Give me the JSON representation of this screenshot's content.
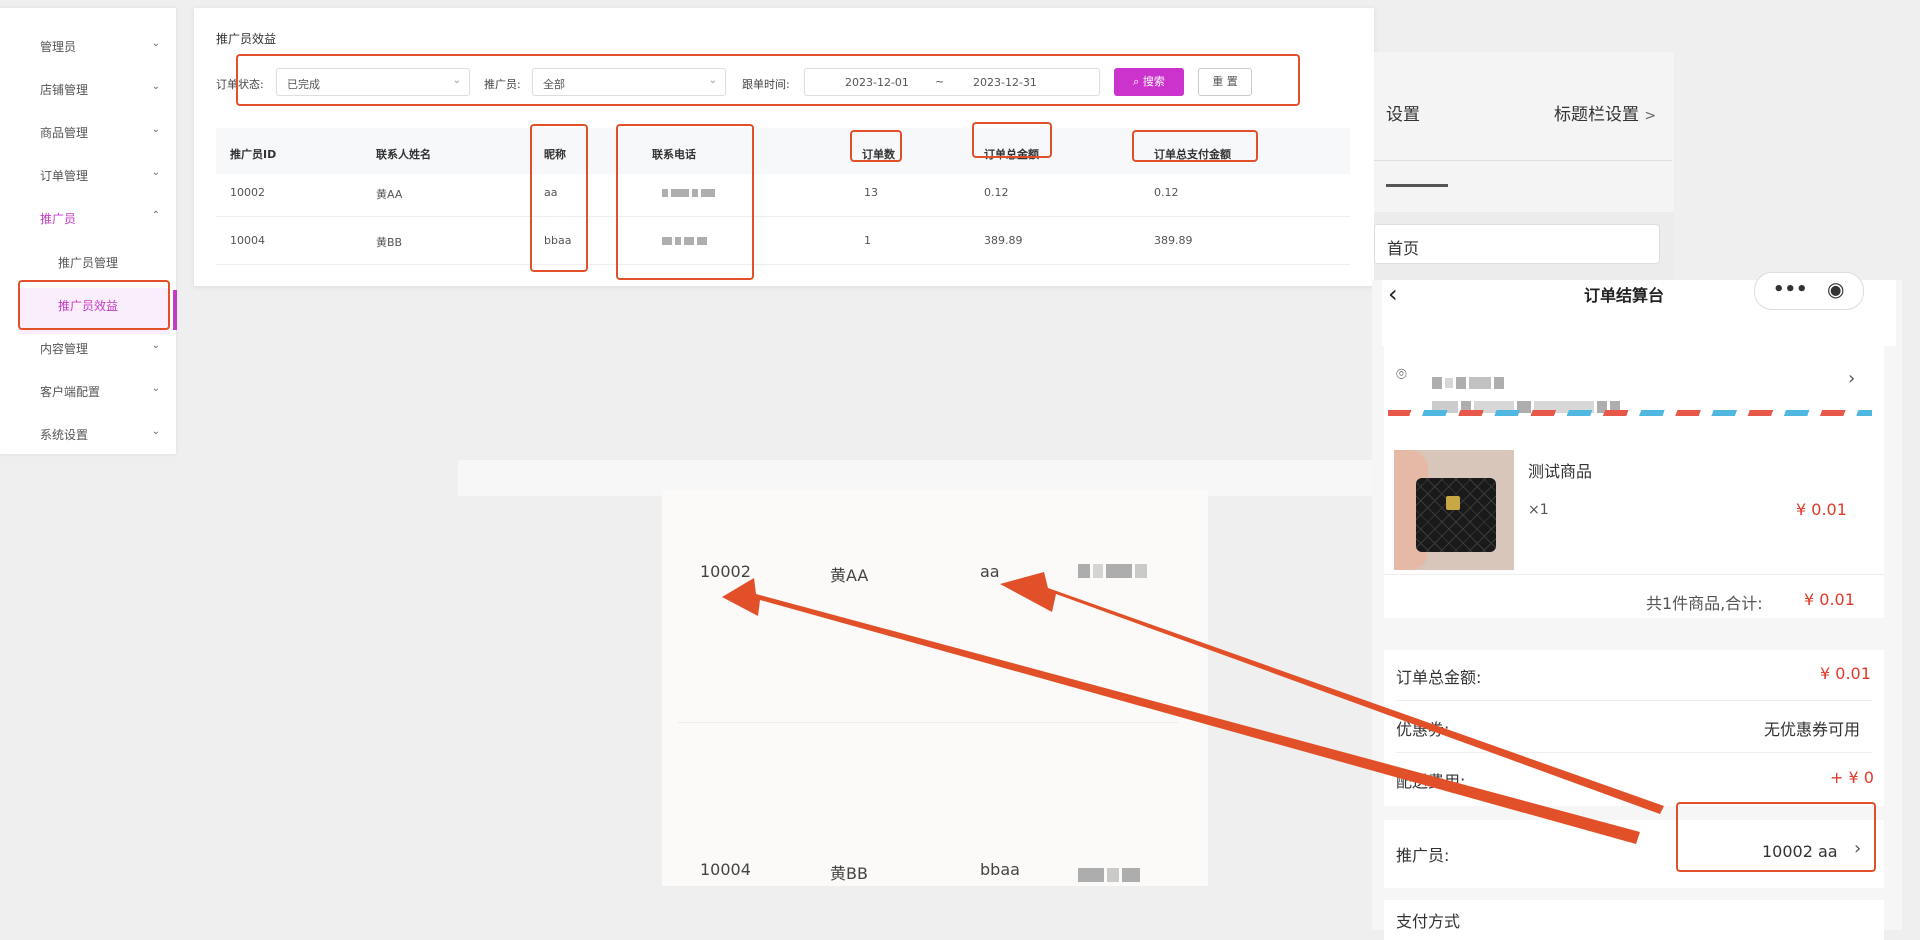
{
  "sidebar": {
    "items": [
      {
        "label": "管理员",
        "chevron": "v"
      },
      {
        "label": "店铺管理",
        "chevron": "v"
      },
      {
        "label": "商品管理",
        "chevron": "v"
      },
      {
        "label": "订单管理",
        "chevron": "v"
      },
      {
        "label": "推广员",
        "chevron": "^"
      },
      {
        "label": "内容管理",
        "chevron": "v"
      },
      {
        "label": "客户端配置",
        "chevron": "v"
      },
      {
        "label": "系统设置",
        "chevron": "v"
      }
    ],
    "sub_items": [
      "推广员管理",
      "推广员效益"
    ]
  },
  "panel": {
    "title": "推广员效益",
    "filters": {
      "order_status_label": "订单状态:",
      "order_status_value": "已完成",
      "promoter_label": "推广员:",
      "promoter_value": "全部",
      "date_label": "跟单时间:",
      "date_start": "2023-12-01",
      "date_sep": "~",
      "date_end": "2023-12-31",
      "search_label": "搜索",
      "reset_label": "重 置"
    },
    "columns": [
      "推广员ID",
      "联系人姓名",
      "昵称",
      "联系电话",
      "订单数",
      "订单总金额",
      "订单总支付金额"
    ],
    "rows": [
      {
        "id": "10002",
        "name": "黄AA",
        "nick": "aa",
        "count": "13",
        "total": "0.12",
        "paid": "0.12"
      },
      {
        "id": "10004",
        "name": "黄BB",
        "nick": "bbaa",
        "count": "1",
        "total": "389.89",
        "paid": "389.89"
      }
    ]
  },
  "zoom": {
    "row1": {
      "id": "10002",
      "name": "黄AA",
      "nick": "aa"
    },
    "row2": {
      "id": "10004",
      "name": "黄BB",
      "nick": "bbaa"
    }
  },
  "settings": {
    "tab1": "设置",
    "tab2": "标题栏设置",
    "input_value": "首页"
  },
  "checkout": {
    "title": "订单结算台",
    "product_name": "测试商品",
    "qty": "×1",
    "product_price": "¥ 0.01",
    "summary_prefix": "共1件商品,合计:",
    "summary_total": "¥ 0.01",
    "order_total_label": "订单总金额:",
    "order_total_value": "¥ 0.01",
    "coupon_label": "优惠券:",
    "coupon_value": "无优惠券可用",
    "shipping_label": "配送费用:",
    "shipping_value": "+ ¥ 0",
    "promoter_label": "推广员:",
    "promoter_value": "10002 aa",
    "payment_label": "支付方式"
  },
  "colors": {
    "accent": "#cc33cc",
    "annotation": "#e2502a",
    "price": "#e03a2a"
  }
}
